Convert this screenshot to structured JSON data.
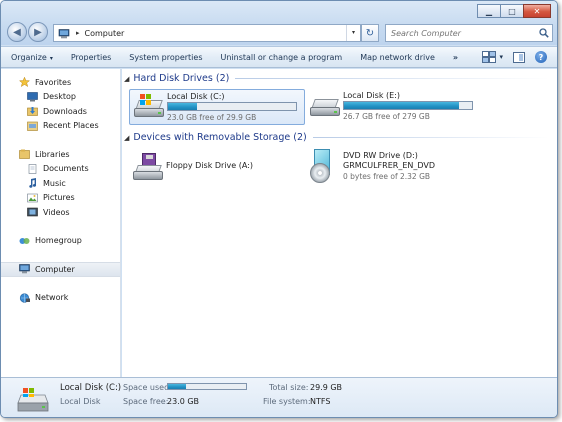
{
  "window": {
    "caption_buttons": {
      "minimize": "▁",
      "maximize": "□",
      "close": "✕"
    }
  },
  "address_bar": {
    "path": [
      "Computer"
    ],
    "separator": "▸",
    "dropdown": "▾",
    "refresh_glyph": "↻"
  },
  "search": {
    "placeholder": "Search Computer"
  },
  "nav_buttons": {
    "back": "◀",
    "forward": "▶"
  },
  "command_bar": {
    "items": [
      "Organize",
      "Properties",
      "System properties",
      "Uninstall or change a program",
      "Map network drive"
    ],
    "organize_arrow": "▾",
    "more": "»",
    "view_arrow": "▾",
    "help": "?"
  },
  "nav_pane": {
    "favorites": {
      "label": "Favorites",
      "items": [
        "Desktop",
        "Downloads",
        "Recent Places"
      ]
    },
    "libraries": {
      "label": "Libraries",
      "items": [
        "Documents",
        "Music",
        "Pictures",
        "Videos"
      ]
    },
    "homegroup": "Homegroup",
    "computer": "Computer",
    "network": "Network"
  },
  "groups": {
    "hdd": {
      "header": "Hard Disk Drives (2)",
      "drives": [
        {
          "name": "Local Disk (C:)",
          "free_text": "23.0 GB free of 29.9 GB",
          "used_fraction": 0.23,
          "selected": true
        },
        {
          "name": "Local Disk (E:)",
          "free_text": "26.7 GB free of 279 GB",
          "used_fraction": 0.9,
          "selected": false
        }
      ]
    },
    "removable": {
      "header": "Devices with Removable Storage (2)",
      "devices": [
        {
          "name": "Floppy Disk Drive (A:)"
        },
        {
          "name": "DVD RW Drive (D:)",
          "label": "GRMCULFRER_EN_DVD",
          "free_text": "0 bytes free of 2.32 GB"
        }
      ]
    }
  },
  "details": {
    "name": "Local Disk (C:)",
    "type": "Local Disk",
    "space_used_label": "Space used:",
    "space_used_fraction": 0.23,
    "space_free_label": "Space free:",
    "space_free_value": "23.0 GB",
    "total_size_label": "Total size:",
    "total_size_value": "29.9 GB",
    "file_system_label": "File system:",
    "file_system_value": "NTFS"
  },
  "colors": {
    "accent_bar": "#2291c4",
    "group_header": "#1e3a8a",
    "selection_border": "#84acdd"
  }
}
